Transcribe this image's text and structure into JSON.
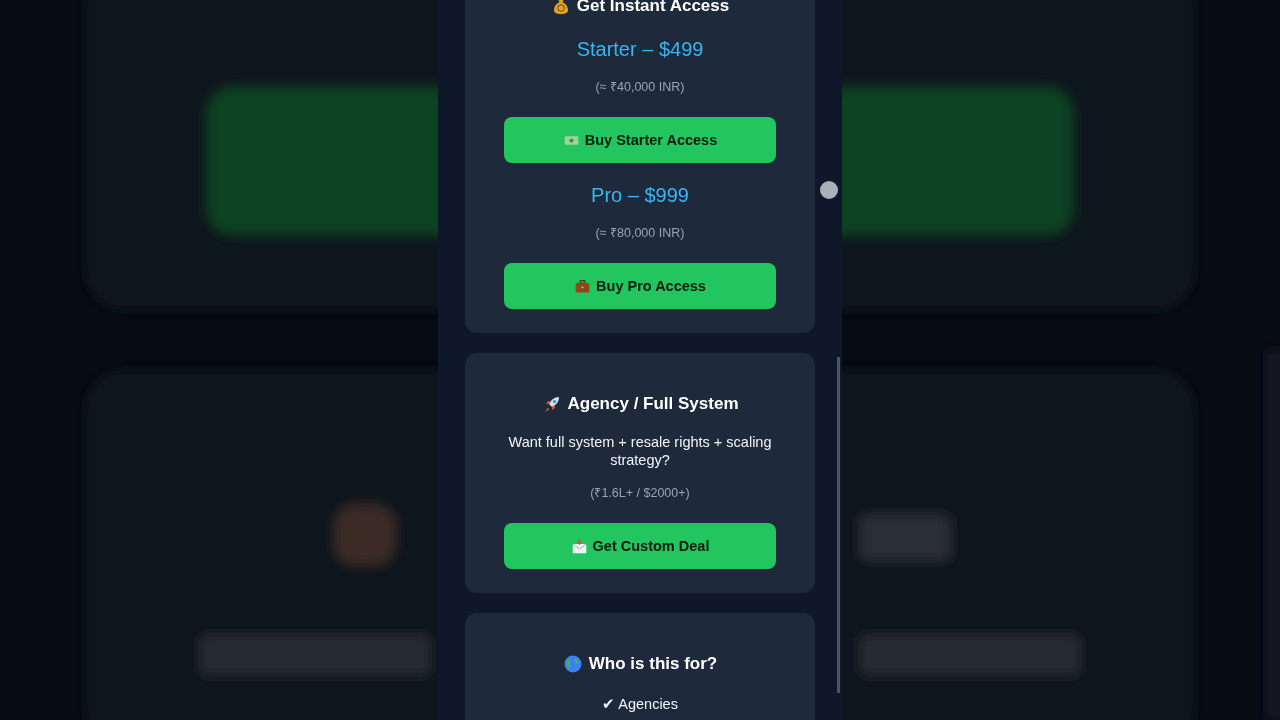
{
  "cards": [
    {
      "kind": "pricing",
      "title": "Get Instant Access",
      "plans": [
        {
          "name": "Starter – $499",
          "inr": "(≈ ₹40,000 INR)",
          "button": "Buy Starter Access"
        },
        {
          "name": "Pro – $999",
          "inr": "(≈ ₹80,000 INR)",
          "button": "Buy Pro Access"
        }
      ]
    },
    {
      "kind": "offer",
      "title": "Agency / Full System",
      "text": "Want full system + resale rights + scaling strategy?",
      "range": "(₹1.6L+ / $2000+)",
      "button": "Get Custom Deal"
    },
    {
      "kind": "list",
      "title": "Who is this for?",
      "items": [
        "✔ Agencies"
      ]
    }
  ]
}
